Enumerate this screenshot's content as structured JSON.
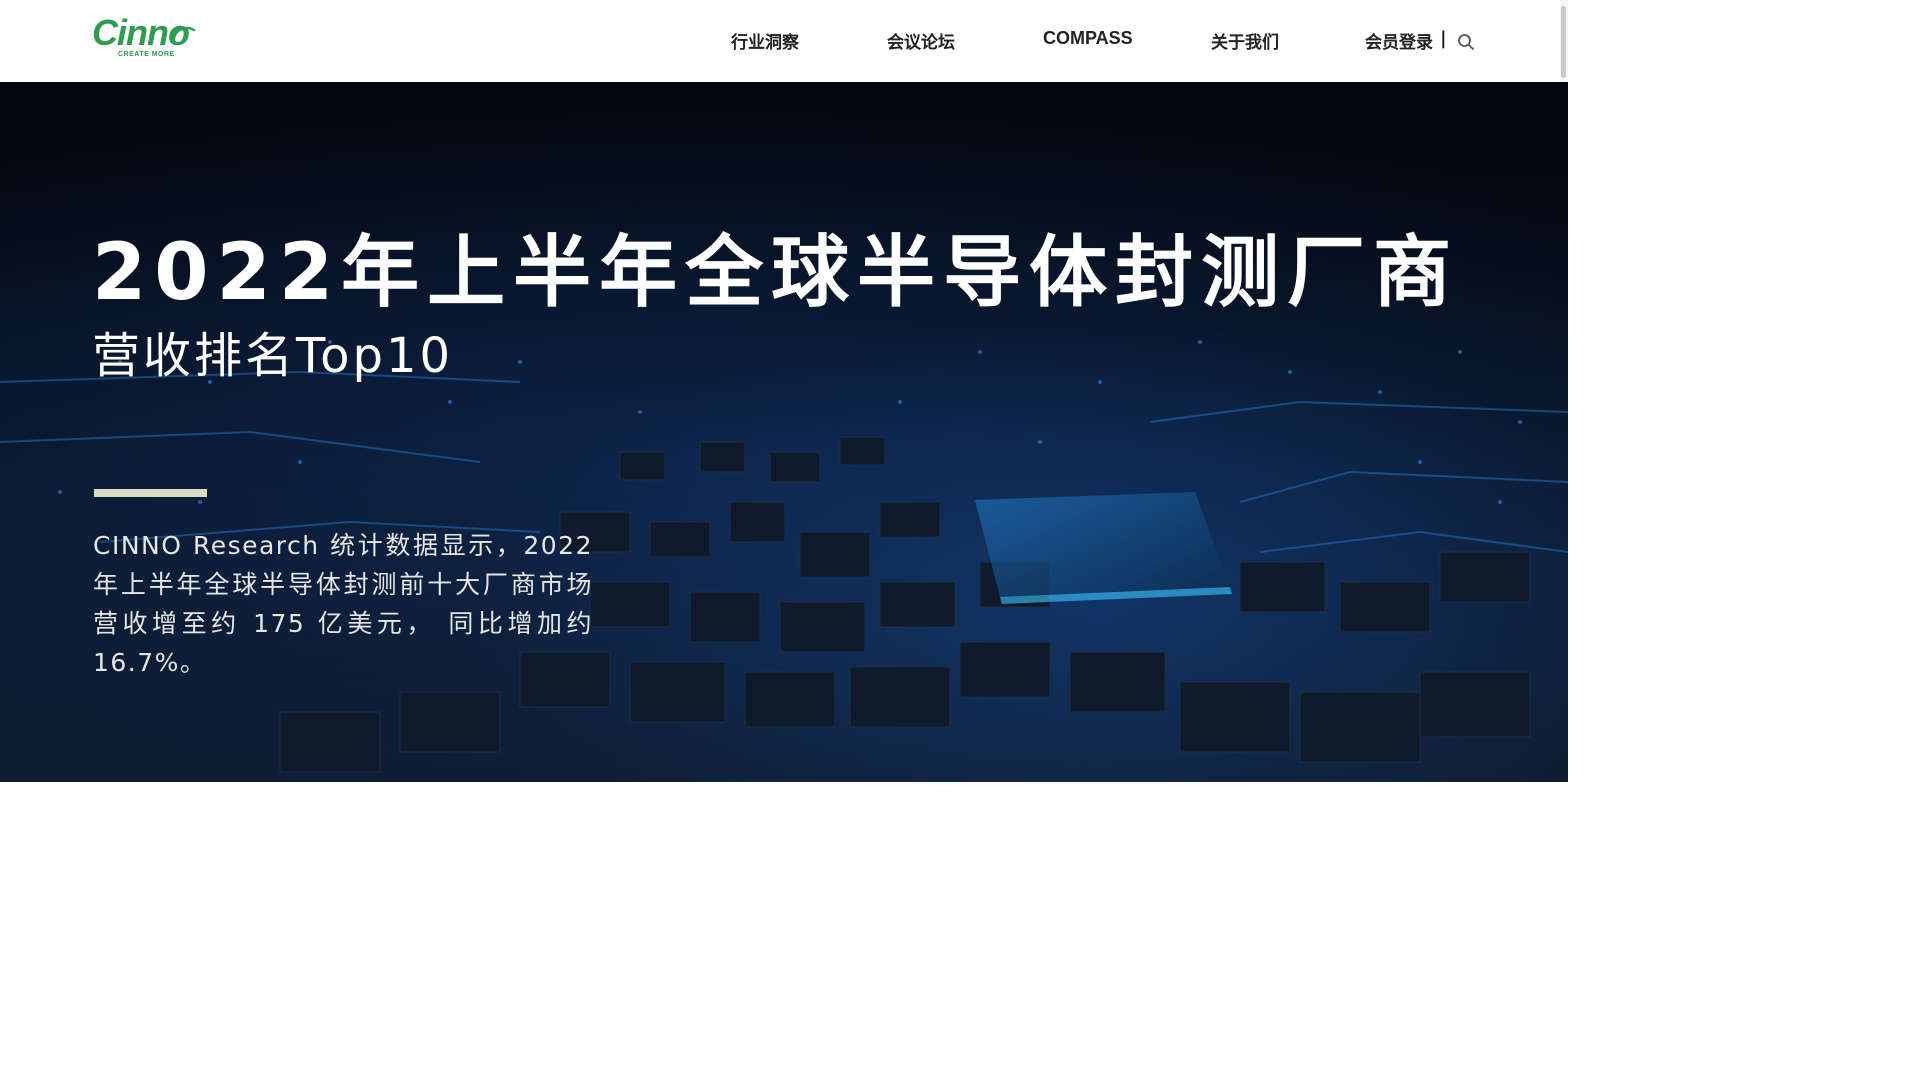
{
  "header": {
    "logo": {
      "text": "Cinno",
      "tagline": "CREATE MORE",
      "color": "#2e9d4f"
    },
    "nav": [
      {
        "label": "行业洞察"
      },
      {
        "label": "会议论坛"
      },
      {
        "label": "COMPASS"
      },
      {
        "label": "关于我们"
      },
      {
        "label": "会员登录"
      }
    ],
    "separator": "|",
    "search_icon": "search-icon"
  },
  "hero": {
    "title": "2022年上半年全球半导体封测厂商",
    "subtitle": "营收排名Top10",
    "accent_color": "#d9d9c4",
    "description": "CINNO Research 统计数据显示，2022 年上半年全球半导体封测前十大厂商市场营收增至约 175 亿美元， 同比增加约 16.7%。"
  }
}
